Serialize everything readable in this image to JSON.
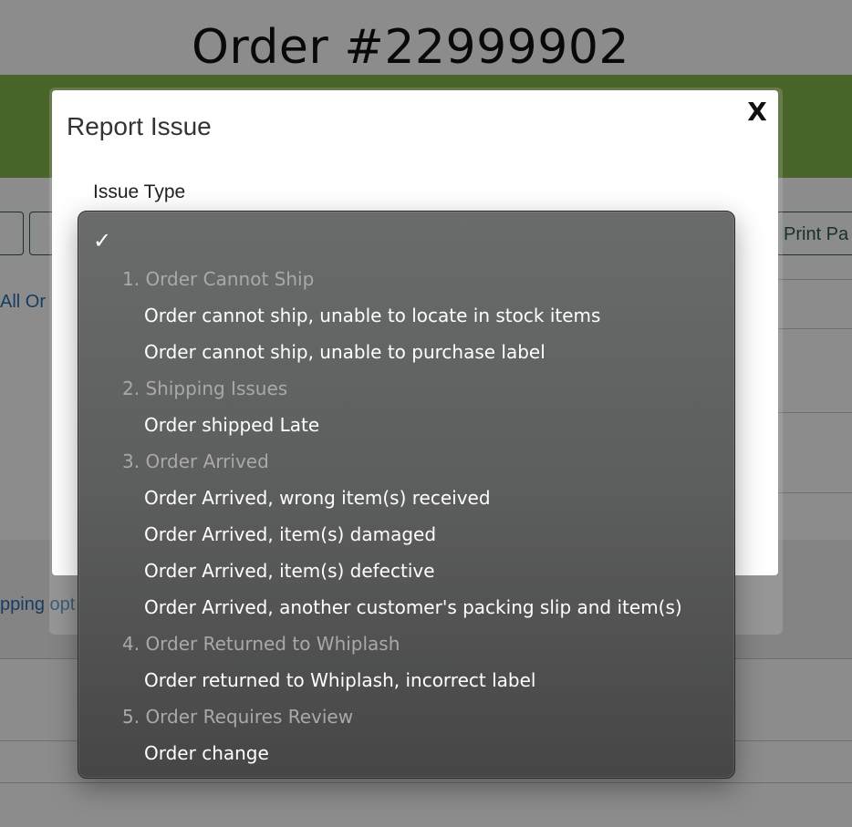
{
  "page": {
    "title": "Order #22999902",
    "btn_left1": "e",
    "btn_print": "Print Pa",
    "link_all_orders": "All Or",
    "link_shipping": "pping opt"
  },
  "modal": {
    "title": "Report Issue",
    "close": "X",
    "issue_type_label": "Issue Type"
  },
  "dropdown": {
    "selected_marker": "✓",
    "rows": [
      {
        "kind": "group",
        "label": "1. Order Cannot Ship"
      },
      {
        "kind": "option",
        "label": "Order cannot ship, unable to locate in stock items"
      },
      {
        "kind": "option",
        "label": "Order cannot ship, unable to purchase label"
      },
      {
        "kind": "group",
        "label": "2. Shipping Issues"
      },
      {
        "kind": "option",
        "label": "Order shipped Late"
      },
      {
        "kind": "group",
        "label": "3. Order Arrived"
      },
      {
        "kind": "option",
        "label": "Order Arrived, wrong item(s) received"
      },
      {
        "kind": "option",
        "label": "Order Arrived, item(s) damaged"
      },
      {
        "kind": "option",
        "label": "Order Arrived, item(s) defective"
      },
      {
        "kind": "option",
        "label": "Order Arrived, another customer's packing slip and item(s)"
      },
      {
        "kind": "group",
        "label": "4. Order Returned to Whiplash"
      },
      {
        "kind": "option",
        "label": "Order returned to Whiplash, incorrect label"
      },
      {
        "kind": "group",
        "label": "5. Order Requires Review"
      },
      {
        "kind": "option",
        "label": "Order change"
      }
    ]
  }
}
